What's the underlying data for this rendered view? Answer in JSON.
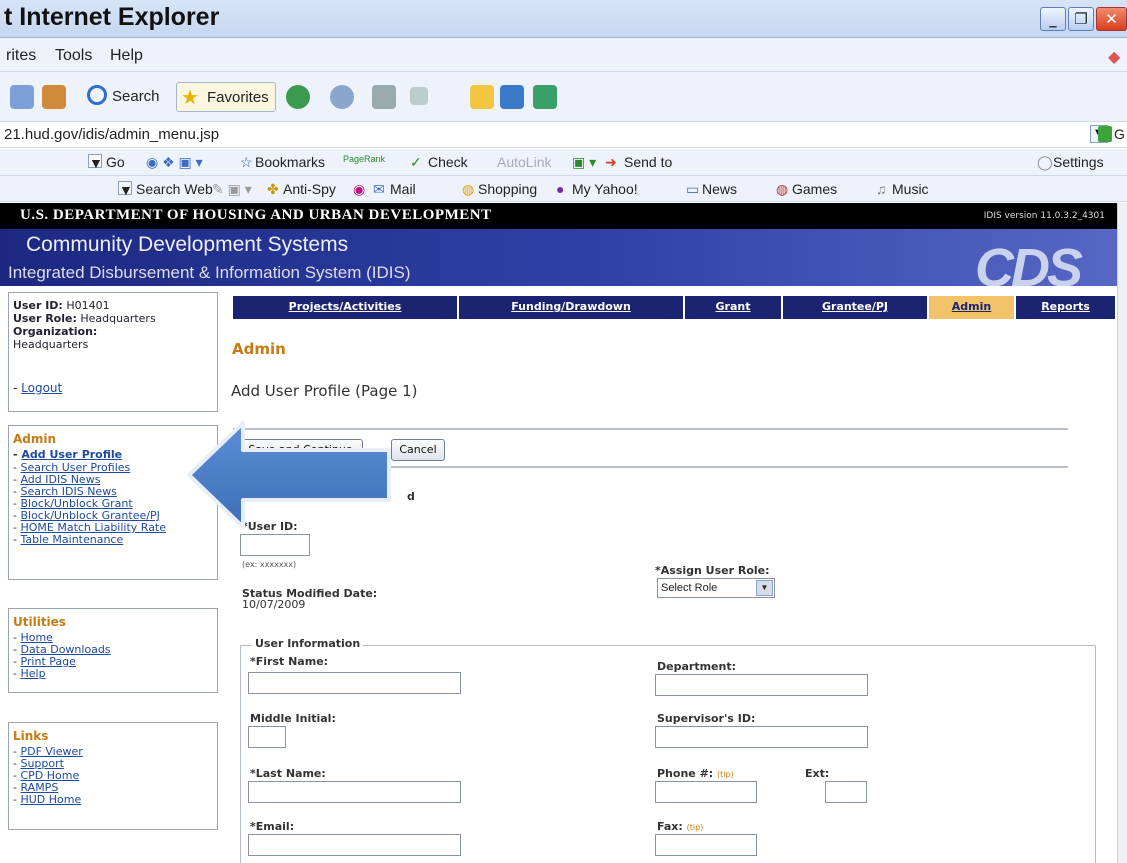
{
  "browser": {
    "title": "t Internet Explorer",
    "menu": [
      "rites",
      "Tools",
      "Help"
    ],
    "toolbar": {
      "search": "Search",
      "favorites": "Favorites"
    },
    "address": "21.hud.gov/idis/admin_menu.jsp",
    "go_label": "G",
    "bar2": {
      "go": "Go",
      "bookmarks": "Bookmarks",
      "pagerank": "PageRank",
      "check": "Check",
      "autolink": "AutoLink",
      "send_to": "Send to",
      "settings": "Settings"
    },
    "bar3": {
      "search_web": "Search Web",
      "anti_spy": "Anti-Spy",
      "mail": "Mail",
      "shopping": "Shopping",
      "my_yahoo": "My Yahoo!",
      "news": "News",
      "games": "Games",
      "music": "Music"
    }
  },
  "hud": {
    "department": "U.S. DEPARTMENT OF HOUSING AND URBAN DEVELOPMENT",
    "version": "IDIS version 11.0.3.2_4301",
    "line1": "Community Development Systems",
    "line2": "Integrated Disbursement & Information System (IDIS)",
    "logo": "CDS"
  },
  "user": {
    "id_label": "User ID:",
    "id_value": "H01401",
    "role_label": "User Role:",
    "role_value": "Headquarters",
    "org_label": "Organization:",
    "org_value": "Headquarters",
    "logout": "Logout"
  },
  "admin_menu": {
    "heading": "Admin",
    "items": [
      "Add User Profile",
      "Search User Profiles",
      "Add IDIS News",
      "Search IDIS News",
      "Block/Unblock Grant",
      "Block/Unblock Grantee/PJ",
      "HOME Match Liability Rate",
      "Table Maintenance"
    ]
  },
  "utilities_menu": {
    "heading": "Utilities",
    "items": [
      "Home",
      "Data Downloads",
      "Print Page",
      "Help"
    ]
  },
  "links_menu": {
    "heading": "Links",
    "items": [
      "PDF Viewer",
      "Support",
      "CPD Home",
      "RAMPS",
      "HUD Home"
    ]
  },
  "tabs": [
    "Projects/Activities",
    "Funding/Drawdown",
    "Grant",
    "Grantee/PJ",
    "Admin",
    "Reports"
  ],
  "main": {
    "section": "Admin",
    "page_title": "Add User Profile (Page 1)",
    "save_continue": "Save and Continue",
    "cancel": "Cancel",
    "required_note": "d",
    "user_id_label": "*User ID:",
    "user_id_hint": "(ex: xxxxxxx)",
    "assign_role_label": "*Assign User Role:",
    "role_select": "Select Role",
    "status_date_label": "Status Modified Date:",
    "status_date_value": "10/07/2009",
    "user_info_legend": "User Information",
    "first_name": "*First Name:",
    "department": "Department:",
    "middle_initial": "Middle Initial:",
    "supervisor_id": "Supervisor's ID:",
    "last_name": "*Last Name:",
    "phone": "Phone #:",
    "tip": "(tip)",
    "ext": "Ext:",
    "email": "*Email:",
    "fax": "Fax:"
  }
}
